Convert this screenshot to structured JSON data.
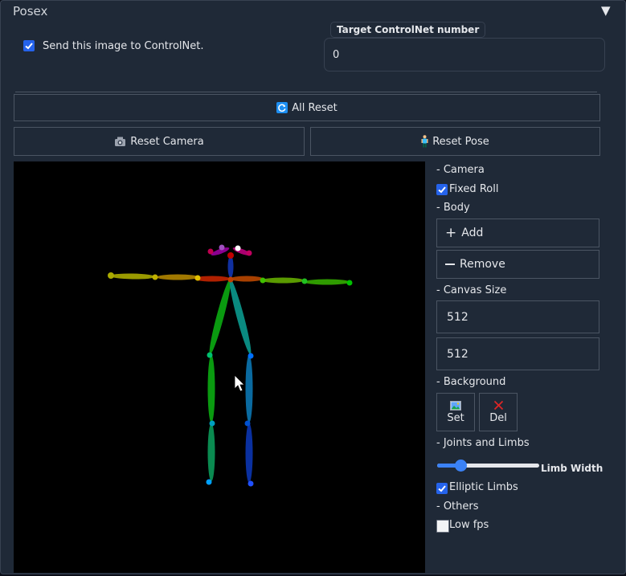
{
  "header": {
    "title": "Posex",
    "toggle": "▼"
  },
  "send": {
    "label": "Send this image to ControlNet.",
    "checked": true
  },
  "target": {
    "label": "Target ControlNet number",
    "value": "0"
  },
  "buttons": {
    "all_reset": "All Reset",
    "reset_camera": "Reset Camera",
    "reset_pose": "Reset Pose"
  },
  "side": {
    "camera_heading": "- Camera",
    "fixed_roll": "Fixed Roll",
    "body_heading": "- Body",
    "add": "Add",
    "remove": "Remove",
    "canvas_heading": "- Canvas Size",
    "width": "512",
    "height": "512",
    "background_heading": "- Background",
    "set": "Set",
    "del": "Del",
    "joints_heading": "- Joints and Limbs",
    "limb_width": "Limb Width",
    "limb_width_level": 0.23,
    "elliptic": "Elliptic Limbs",
    "others_heading": "- Others",
    "low_fps": "Low fps"
  }
}
